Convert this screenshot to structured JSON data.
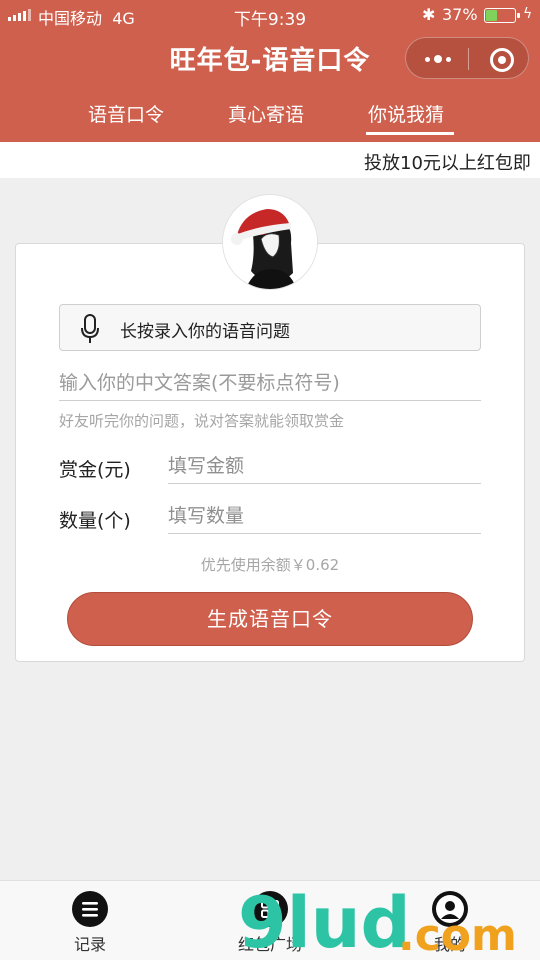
{
  "status_bar": {
    "carrier": "中国移动",
    "network": "4G",
    "time": "下午9:39",
    "battery_percent": "37%"
  },
  "header": {
    "title": "旺年包-语音口令",
    "background_color": "#cf604d"
  },
  "tabs": [
    {
      "label": "语音口令",
      "active": false
    },
    {
      "label": "真心寄语",
      "active": false
    },
    {
      "label": "你说我猜",
      "active": true
    }
  ],
  "marquee": {
    "text": "投放10元以上红包即"
  },
  "form": {
    "voice_button_label": "长按录入你的语音问题",
    "answer_placeholder": "输入你的中文答案(不要标点符号)",
    "answer_hint": "好友听完你的问题，说对答案就能领取赏金",
    "reward_label": "赏金(元)",
    "reward_placeholder": "填写金额",
    "quantity_label": "数量(个)",
    "quantity_placeholder": "填写数量",
    "balance_text": "优先使用余额￥0.62",
    "submit_label": "生成语音口令"
  },
  "bottom_nav": [
    {
      "label": "记录",
      "icon": "list-icon"
    },
    {
      "label": "红包广场",
      "icon": "grid-icon"
    },
    {
      "label": "我的",
      "icon": "user-icon"
    }
  ],
  "watermark": {
    "main": "9lud",
    "suffix": ".com"
  }
}
